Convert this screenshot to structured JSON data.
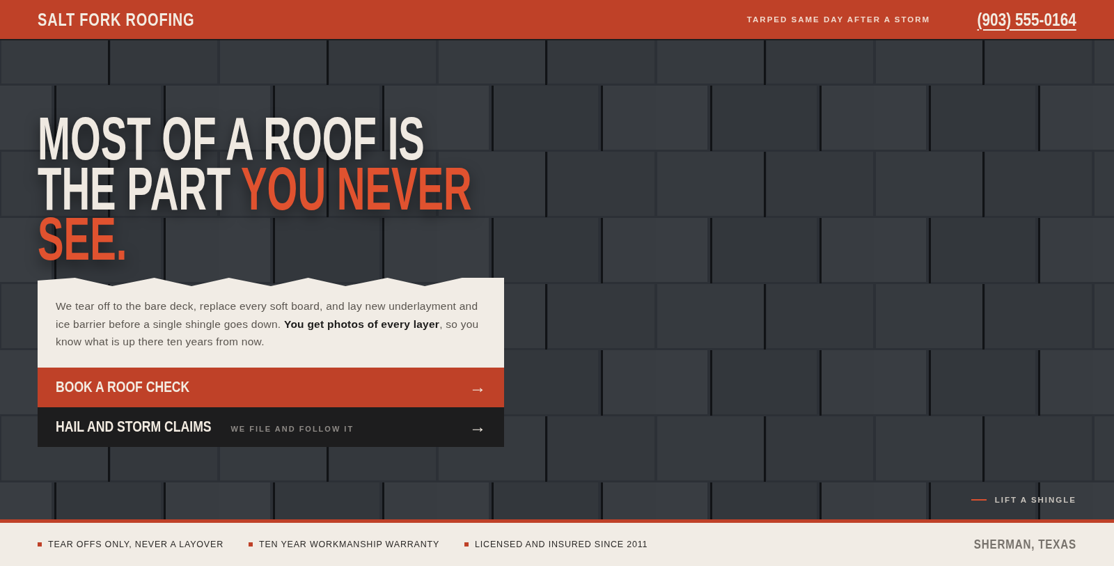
{
  "header": {
    "brand": "SALT FORK ROOFING",
    "tagline": "TARPED SAME DAY AFTER A STORM",
    "phone": "(903) 555-0164"
  },
  "hero": {
    "headline": [
      [
        {
          "text": "MOST OF A ROOF IS",
          "accent": false
        }
      ],
      [
        {
          "text": "THE PART",
          "accent": false
        },
        {
          "text": "YOU NEVER",
          "accent": true
        }
      ],
      [
        {
          "text": "SEE.",
          "accent": true
        }
      ]
    ],
    "intro": "We tear off to the bare deck, replace every soft board, and lay new underlayment and ice barrier before a single shingle goes down. **You get photos of every layer**, so you know what is up there ten years from now.",
    "buttons": [
      {
        "kind": "primary",
        "label": "BOOK A ROOF CHECK",
        "arrow": "→"
      },
      {
        "kind": "secondary",
        "label": "HAIL AND STORM CLAIMS",
        "sublabel": "WE FILE AND FOLLOW IT",
        "arrow": "→"
      }
    ],
    "lift_label": "LIFT A SHINGLE"
  },
  "footer": {
    "features": [
      "TEAR OFFS ONLY, NEVER A LAYOVER",
      "TEN YEAR WORKMANSHIP WARRANTY",
      "LICENSED AND INSURED SINCE 2011"
    ],
    "location": "SHERMAN, TEXAS"
  }
}
